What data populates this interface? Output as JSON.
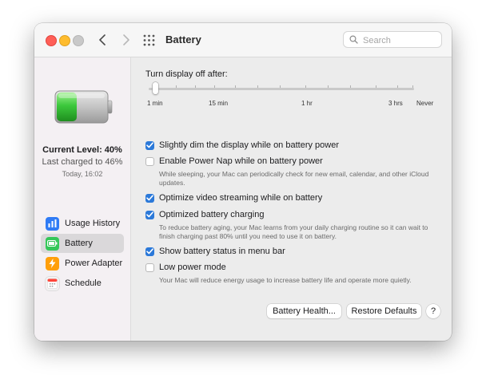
{
  "window": {
    "title": "Battery",
    "search_placeholder": "Search"
  },
  "sidebar": {
    "current_level": "Current Level: 40%",
    "last_charged": "Last charged to 46%",
    "timestamp": "Today, 16:02",
    "battery_level_fraction": 0.4,
    "items": [
      {
        "label": "Usage History",
        "icon": "bar-chart-icon",
        "color": "#2f7bf5"
      },
      {
        "label": "Battery",
        "icon": "battery-icon",
        "color": "#34c759"
      },
      {
        "label": "Power Adapter",
        "icon": "bolt-icon",
        "color": "#ff9f0a"
      },
      {
        "label": "Schedule",
        "icon": "calendar-icon",
        "color": "#ff453a"
      }
    ],
    "selected": "Battery"
  },
  "display_slider": {
    "label": "Turn display off after:",
    "ticks": [
      "1 min",
      "15 min",
      "1 hr",
      "3 hrs",
      "Never"
    ],
    "value": "1 min"
  },
  "options": [
    {
      "label": "Slightly dim the display while on battery power",
      "checked": true
    },
    {
      "label": "Enable Power Nap while on battery power",
      "checked": false,
      "description": "While sleeping, your Mac can periodically check for new email, calendar, and other iCloud updates."
    },
    {
      "label": "Optimize video streaming while on battery",
      "checked": true
    },
    {
      "label": "Optimized battery charging",
      "checked": true,
      "description": "To reduce battery aging, your Mac learns from your daily charging routine so it can wait to finish charging past 80% until you need to use it on battery."
    },
    {
      "label": "Show battery status in menu bar",
      "checked": true
    },
    {
      "label": "Low power mode",
      "checked": false,
      "description": "Your Mac will reduce energy usage to increase battery life and operate more quietly."
    }
  ],
  "buttons": {
    "battery_health": "Battery Health...",
    "restore_defaults": "Restore Defaults",
    "help": "?"
  },
  "colors": {
    "accent": "#2b79d9",
    "battery_green": "#3cc83c"
  }
}
